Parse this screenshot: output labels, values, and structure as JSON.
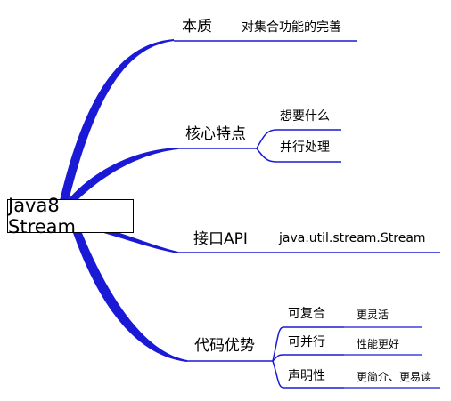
{
  "root": "Java8 Stream",
  "branches": [
    {
      "label": "本质",
      "children": [
        {
          "label": "对集合功能的完善"
        }
      ]
    },
    {
      "label": "核心特点",
      "children": [
        {
          "label": "想要什么"
        },
        {
          "label": "并行处理"
        }
      ]
    },
    {
      "label": "接口API",
      "children": [
        {
          "label": "java.util.stream.Stream"
        }
      ]
    },
    {
      "label": "代码优势",
      "children": [
        {
          "label": "可复合",
          "note": "更灵活"
        },
        {
          "label": "可并行",
          "note": "性能更好"
        },
        {
          "label": "声明性",
          "note": "更简介、更易读"
        }
      ]
    }
  ],
  "colors": {
    "connector": "#1a1ad6",
    "underline": "#1a1ad6",
    "text": "#000000",
    "root_border": "#000000"
  }
}
